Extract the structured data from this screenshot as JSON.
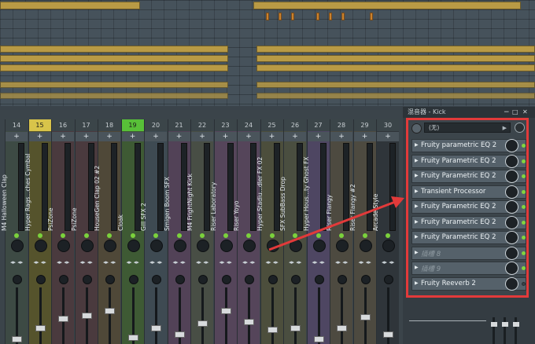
{
  "colors": {
    "accent_red": "#e23a3a",
    "led_green": "#82d43e"
  },
  "panel": {
    "title": "混音器 - Kick",
    "minimize_icon": "−",
    "maximize_icon": "□",
    "close_icon": "✕",
    "preset": "(无)",
    "slots": [
      {
        "name": "Fruity parametric EQ 2",
        "empty": false,
        "led_on": true
      },
      {
        "name": "Fruity Parametric EQ 2",
        "empty": false,
        "led_on": true
      },
      {
        "name": "Fruity Parametric EQ 2",
        "empty": false,
        "led_on": true
      },
      {
        "name": "Transient Processor",
        "empty": false,
        "led_on": true
      },
      {
        "name": "Fruity Parametric EQ 2",
        "empty": false,
        "led_on": true
      },
      {
        "name": "Fruity Parametric EQ 2",
        "empty": false,
        "led_on": true
      },
      {
        "name": "Fruity Parametric EQ 2",
        "empty": false,
        "led_on": true
      },
      {
        "name": "插槽 8",
        "empty": true,
        "led_on": true
      },
      {
        "name": "插槽 9",
        "empty": true,
        "led_on": true
      },
      {
        "name": "Fruity Reeverb 2",
        "empty": false,
        "led_on": false
      }
    ]
  },
  "mixer": {
    "route_symbol": "+",
    "tracks": [
      {
        "number": "14",
        "name": "M4 Halloween Clap",
        "color": "#3d4a44",
        "header": "#3b4549"
      },
      {
        "number": "15",
        "name": "Hyper Rags...ches Cymbal",
        "color": "#55532c",
        "header": "#d8c44a"
      },
      {
        "number": "16",
        "name": "PsiZone",
        "color": "#4a3a3e",
        "header": "#3b4549"
      },
      {
        "number": "17",
        "name": "PsiZone",
        "color": "#4a3a3e",
        "header": "#3b4549"
      },
      {
        "number": "18",
        "name": "HouseGen Clap 02 #2",
        "color": "#4f4838",
        "header": "#3b4549"
      },
      {
        "number": "19",
        "name": "Cloak",
        "color": "#3e5a34",
        "header": "#58c038"
      },
      {
        "number": "20",
        "name": "Gill SFX 2",
        "color": "#3e4a52",
        "header": "#3b4549"
      },
      {
        "number": "21",
        "name": "Smigen Boom SFX",
        "color": "#524257",
        "header": "#3b4549"
      },
      {
        "number": "22",
        "name": "M4 FrightNight Kick",
        "color": "#484e45",
        "header": "#3b4549"
      },
      {
        "number": "23",
        "name": "Riser Laboratory",
        "color": "#55455a",
        "header": "#3b4549"
      },
      {
        "number": "24",
        "name": "Riser Yoyo",
        "color": "#55455a",
        "header": "#3b4549"
      },
      {
        "number": "25",
        "name": "Hyper Stadiu...dler FX 02",
        "color": "#4c4e3c",
        "header": "#3b4549"
      },
      {
        "number": "26",
        "name": "SFX SubBass Drop",
        "color": "#4a4e40",
        "header": "#3b4549"
      },
      {
        "number": "27",
        "name": "Hyper Hous...ty Ghost FX",
        "color": "#4e4662",
        "header": "#3b4549"
      },
      {
        "number": "28",
        "name": "Riser Flangy",
        "color": "#4d4a40",
        "header": "#3b4549"
      },
      {
        "number": "29",
        "name": "Riser Flangy #2",
        "color": "#4d4a40",
        "header": "#3b4549"
      },
      {
        "number": "30",
        "name": "Arcade Style",
        "color": "#2f353a",
        "header": "#3b4549"
      }
    ]
  }
}
